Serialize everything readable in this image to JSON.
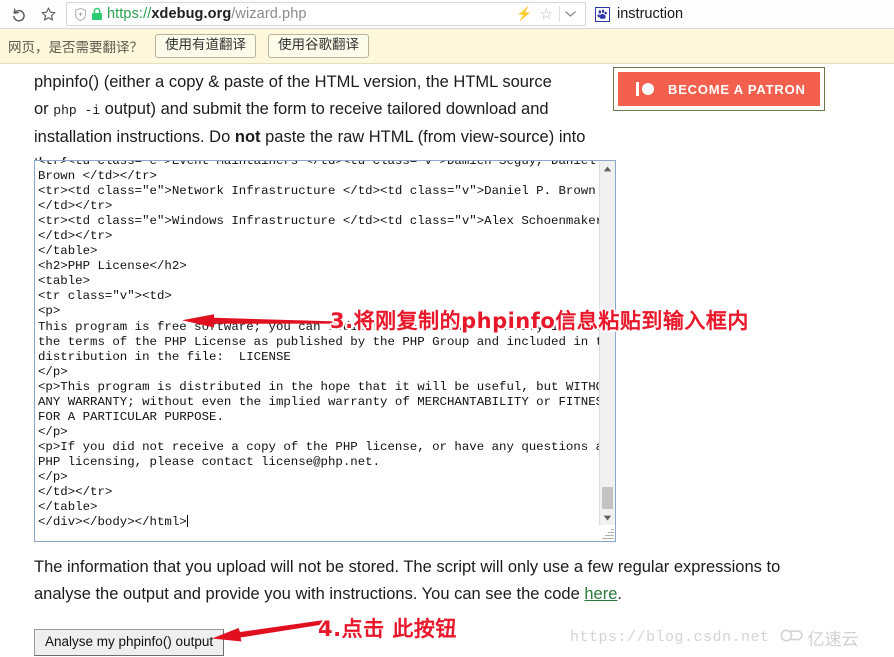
{
  "browser": {
    "back_icon": "back-arrow-icon",
    "bookmark_icon": "star-icon",
    "shield_icon": "shield-icon",
    "lock_icon": "lock-icon",
    "url_scheme": "https://",
    "url_host": "xdebug.org",
    "url_path": "/wizard.php",
    "bolt_icon": "lightning-bolt-icon",
    "favorite_icon": "star-outline-icon",
    "chevron_icon": "chevron-down-icon",
    "extension_icon": "baidu-paw-icon",
    "extension_label": "instruction"
  },
  "translate_bar": {
    "prompt": "网页，是否需要翻译？",
    "youdao_button": "使用有道翻译",
    "google_button": "使用谷歌翻译"
  },
  "content": {
    "intro_1": "phpinfo() (either a copy & paste of the HTML version, the HTML source",
    "intro_2a": "or ",
    "intro_2b": "php -i",
    "intro_2c": " output) and submit the form to receive tailored download and",
    "intro_3a": "installation instructions. Do ",
    "intro_3b": "not",
    "intro_3c": " paste the raw HTML (from view-source) into the form.",
    "patron_button": "BECOME A PATRON",
    "patron_logo_icon": "patreon-logo-icon",
    "textarea_value": "<tr><td class=\"e\">Event Maintainers </td><td class=\"v\">Damien Seguy, Daniel P.\nBrown </td></tr>\n<tr><td class=\"e\">Network Infrastructure </td><td class=\"v\">Daniel P. Brown\n</td></tr>\n<tr><td class=\"e\">Windows Infrastructure </td><td class=\"v\">Alex Schoenmaker\n</td></tr>\n</table>\n<h2>PHP License</h2>\n<table>\n<tr class=\"v\"><td>\n<p>\nThis program is free software; you can redistribute it and/or modify it under\nthe terms of the PHP License as published by the PHP Group and included in the\ndistribution in the file:  LICENSE\n</p>\n<p>This program is distributed in the hope that it will be useful, but WITHOUT\nANY WARRANTY; without even the implied warranty of MERCHANTABILITY or FITNESS\nFOR A PARTICULAR PURPOSE.\n</p>\n<p>If you did not receive a copy of the PHP license, or have any questions about\nPHP licensing, please contact license@php.net.\n</p>\n</td></tr>\n</table>\n</div></body></html>",
    "scrollbar_up_icon": "scroll-up-arrow-icon",
    "scrollbar_down_icon": "scroll-down-arrow-icon",
    "resize_grip_icon": "resize-grip-icon",
    "outro_1": "The information that you upload will not be stored. The script will only use a few regular expressions to",
    "outro_2a": "analyse the output and provide you with instructions. You can see the code ",
    "outro_2b": "here",
    "outro_2c": ".",
    "analyse_button": "Analyse my phpinfo() output"
  },
  "annotations": {
    "step3": "3.将刚复制的phpinfo信息粘贴到输入框内",
    "step3_arrow_icon": "red-arrow-left-icon",
    "step4": "4.点击 此按钮",
    "step4_arrow_icon": "red-arrow-left-icon"
  },
  "watermark": {
    "url": "https://blog.csdn.net",
    "brand": "亿速云",
    "brand_icon": "cloud-logo-icon"
  },
  "colors": {
    "patron_red": "#f4604e",
    "annotation_red": "#e8182a",
    "link_green": "#2a7a39",
    "url_green": "#2aa14f",
    "translate_bg": "#fdf8dc",
    "textarea_border": "#8aa6c8"
  }
}
